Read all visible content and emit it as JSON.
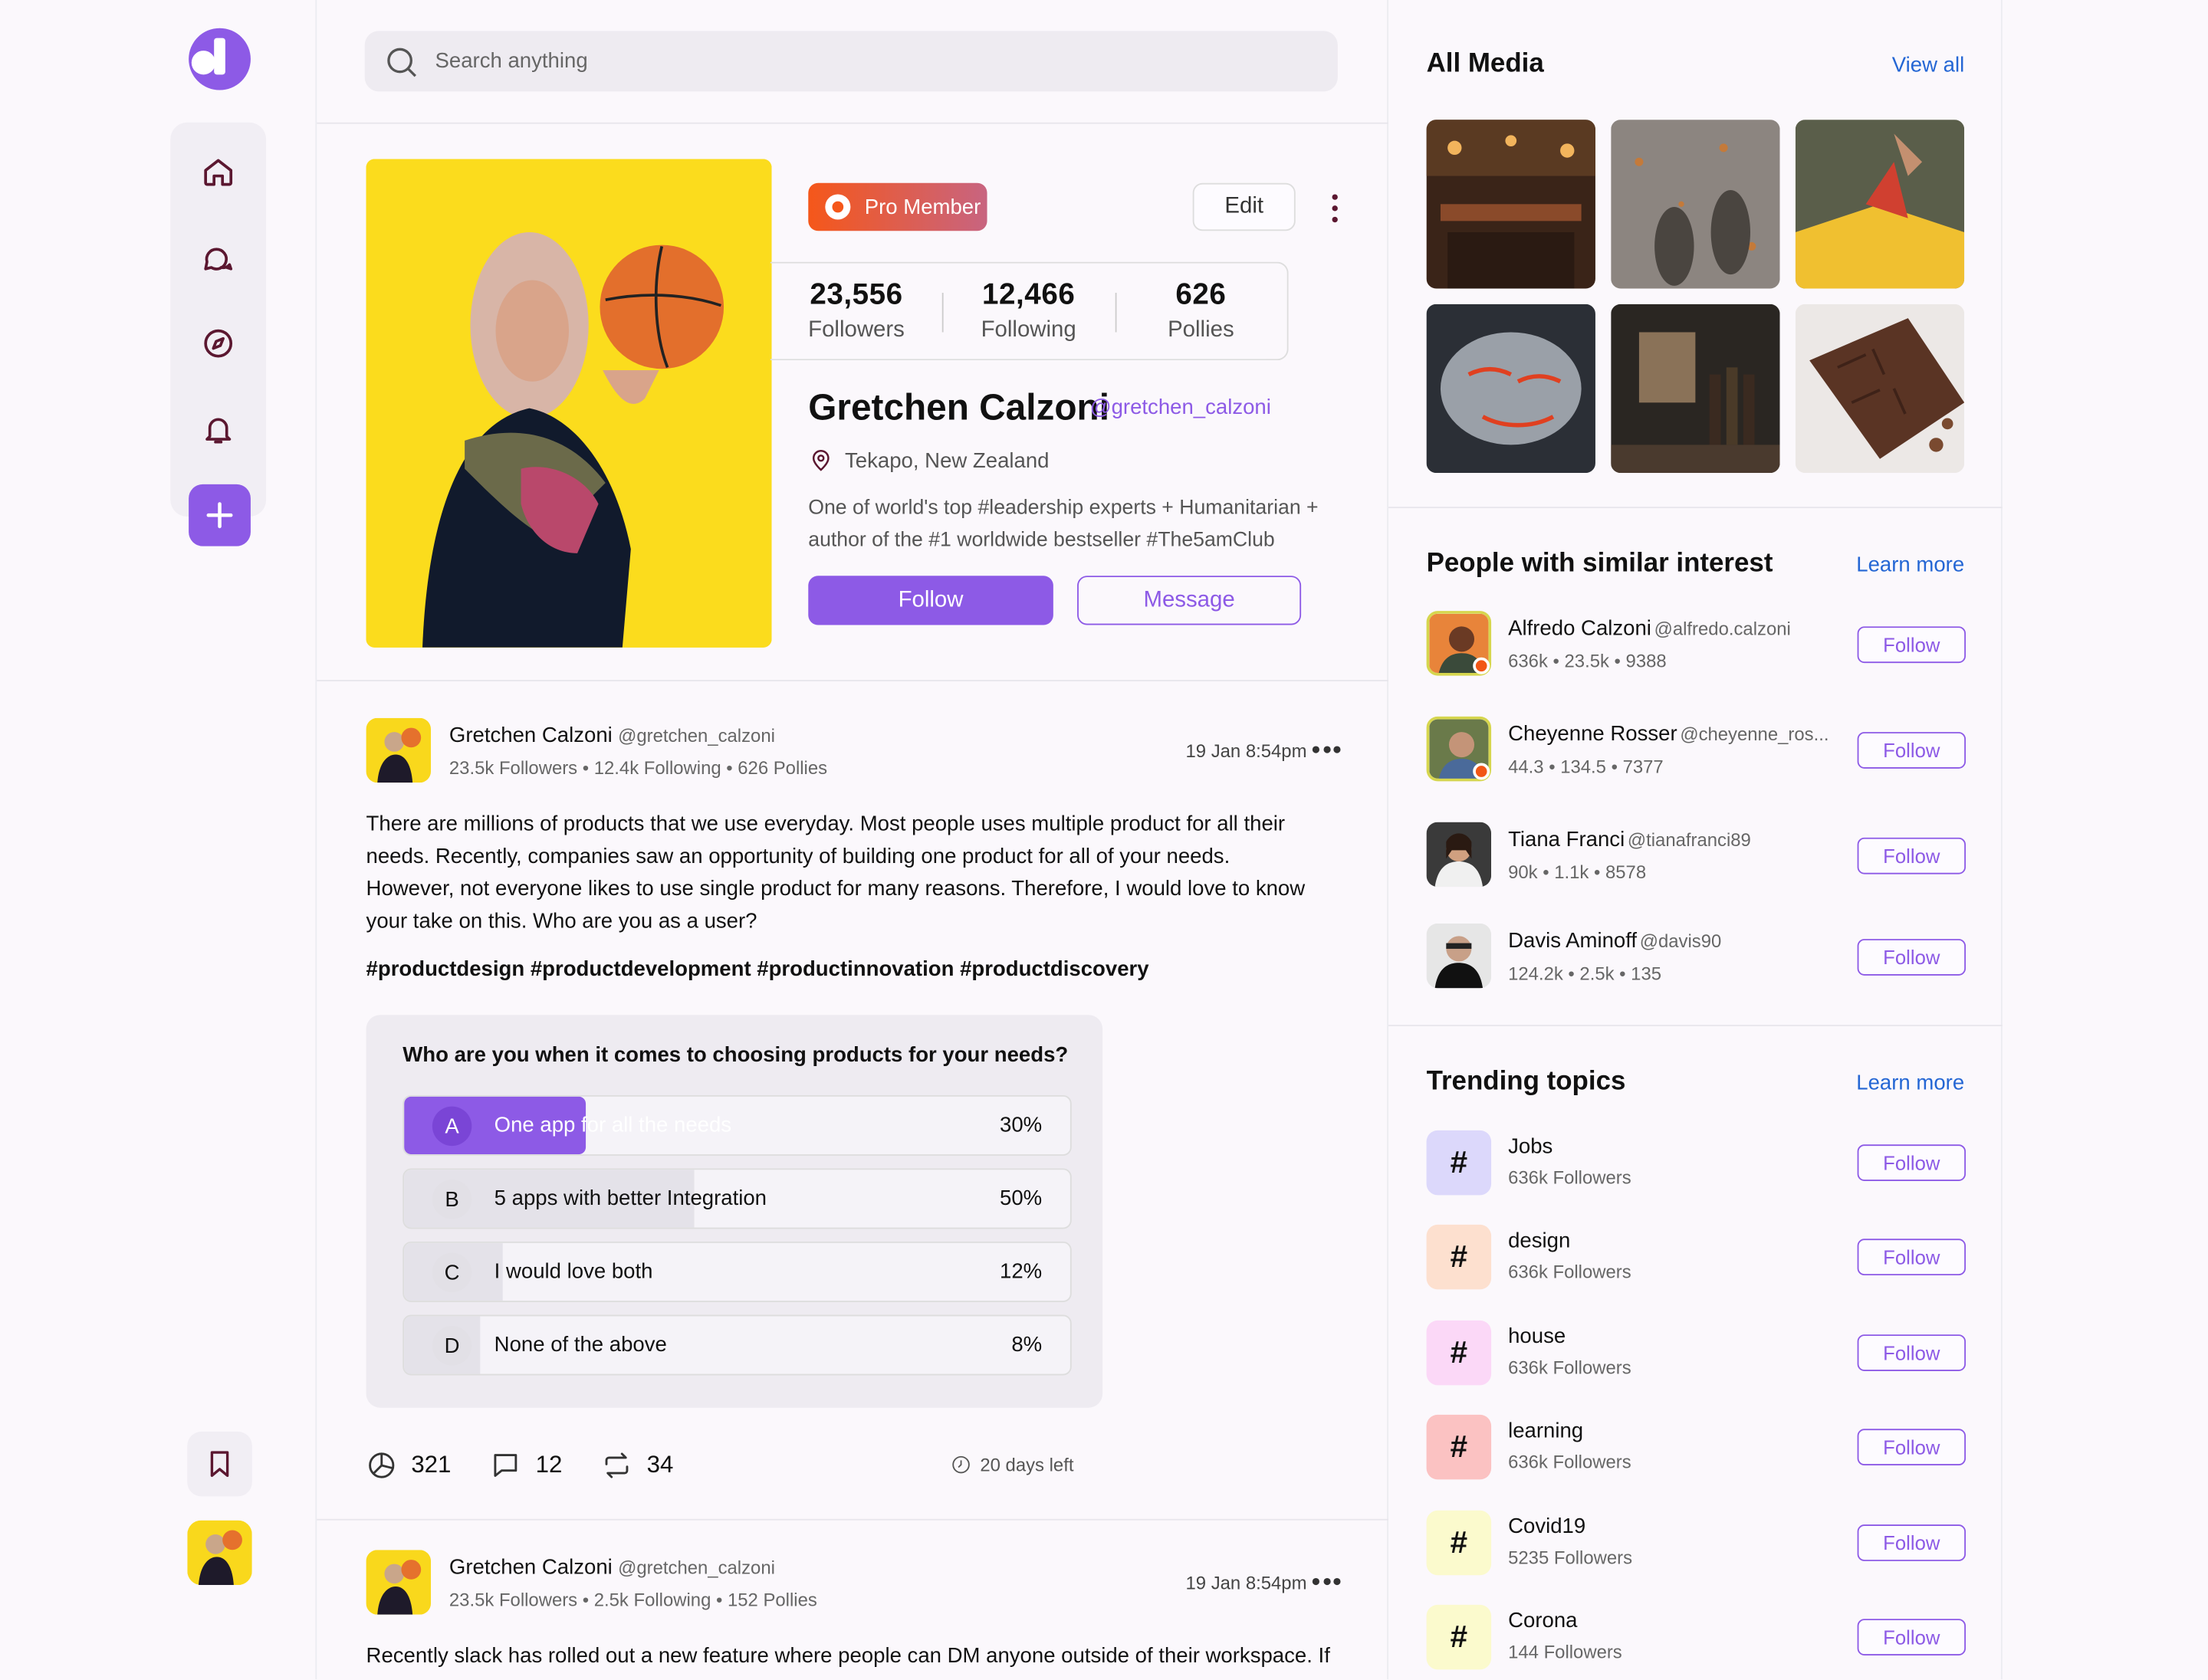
{
  "search": {
    "placeholder": "Search anything"
  },
  "profile": {
    "badge": "Pro Member",
    "edit": "Edit",
    "stats": [
      {
        "value": "23,556",
        "label": "Followers"
      },
      {
        "value": "12,466",
        "label": "Following"
      },
      {
        "value": "626",
        "label": "Pollies"
      }
    ],
    "name": "Gretchen Calzoni",
    "handle": "@gretchen_calzoni",
    "location": "Tekapo, New Zealand",
    "bio": "One of world's top #leadership experts + Humanitarian + author of the #1 worldwide bestseller #The5amClub",
    "follow": "Follow",
    "message": "Message"
  },
  "posts": [
    {
      "author": "Gretchen Calzoni",
      "handle": "@gretchen_calzoni",
      "meta": "23.5k Followers • 12.4k Following • 626 Pollies",
      "date": "19 Jan 8:54pm",
      "text": "There are millions of products that we use everyday. Most people uses multiple product for all their needs. Recently, companies saw an opportunity of building one product for all of your needs. However, not everyone likes to use single product for many reasons. Therefore, I would love to know your take on this. Who are you as a user?",
      "tags": "#productdesign #productdevelopment #productinnovation #productdiscovery",
      "poll": {
        "question": "Who are you when it comes to choosing products for your needs?",
        "options": [
          {
            "letter": "A",
            "text": "One app for all the needs",
            "percent": "30%",
            "value": 30
          },
          {
            "letter": "B",
            "text": "5 apps with better Integration",
            "percent": "50%",
            "value": 50
          },
          {
            "letter": "C",
            "text": "I would love both",
            "percent": "12%",
            "value": 12
          },
          {
            "letter": "D",
            "text": "None of the above",
            "percent": "8%",
            "value": 8
          }
        ]
      },
      "votes": "321",
      "comments": "12",
      "reposts": "34",
      "days_left": "20 days left"
    },
    {
      "author": "Gretchen Calzoni",
      "handle": "@gretchen_calzoni",
      "meta": "23.5k Followers • 2.5k Following • 152 Pollies",
      "date": "19 Jan 8:54pm",
      "text": "Recently slack has rolled out a new feature where people can DM anyone outside of their workspace. If"
    }
  ],
  "media": {
    "title": "All Media",
    "link": "View all"
  },
  "similar": {
    "title": "People with similar interest",
    "link": "Learn more",
    "people": [
      {
        "name": "Alfredo Calzoni",
        "handle": "@alfredo.calzoni",
        "meta": "636k • 23.5k • 9388",
        "follow": "Follow"
      },
      {
        "name": "Cheyenne Rosser",
        "handle": "@cheyenne_ros...",
        "meta": "44.3 • 134.5 • 7377",
        "follow": "Follow"
      },
      {
        "name": "Tiana Franci",
        "handle": "@tianafranci89",
        "meta": "90k • 1.1k • 8578",
        "follow": "Follow"
      },
      {
        "name": "Davis Aminoff",
        "handle": "@davis90",
        "meta": "124.2k • 2.5k • 135",
        "follow": "Follow"
      }
    ]
  },
  "trending": {
    "title": "Trending topics",
    "link": "Learn more",
    "topics": [
      {
        "name": "Jobs",
        "followers": "636k Followers",
        "color": "#dcd8fb",
        "follow": "Follow"
      },
      {
        "name": "design",
        "followers": "636k Followers",
        "color": "#fde0cf",
        "follow": "Follow"
      },
      {
        "name": "house",
        "followers": "636k Followers",
        "color": "#fbd8f7",
        "follow": "Follow"
      },
      {
        "name": "learning",
        "followers": "636k Followers",
        "color": "#fbc2c2",
        "follow": "Follow"
      },
      {
        "name": "Covid19",
        "followers": "5235 Followers",
        "color": "#fbfacd",
        "follow": "Follow"
      },
      {
        "name": "Corona",
        "followers": "144 Followers",
        "color": "#fbfacd",
        "follow": "Follow"
      }
    ]
  },
  "colors": {
    "accent": "#8d5ae6",
    "link": "#2466d4",
    "badge_start": "#f5571a",
    "badge_end": "#c86480"
  }
}
